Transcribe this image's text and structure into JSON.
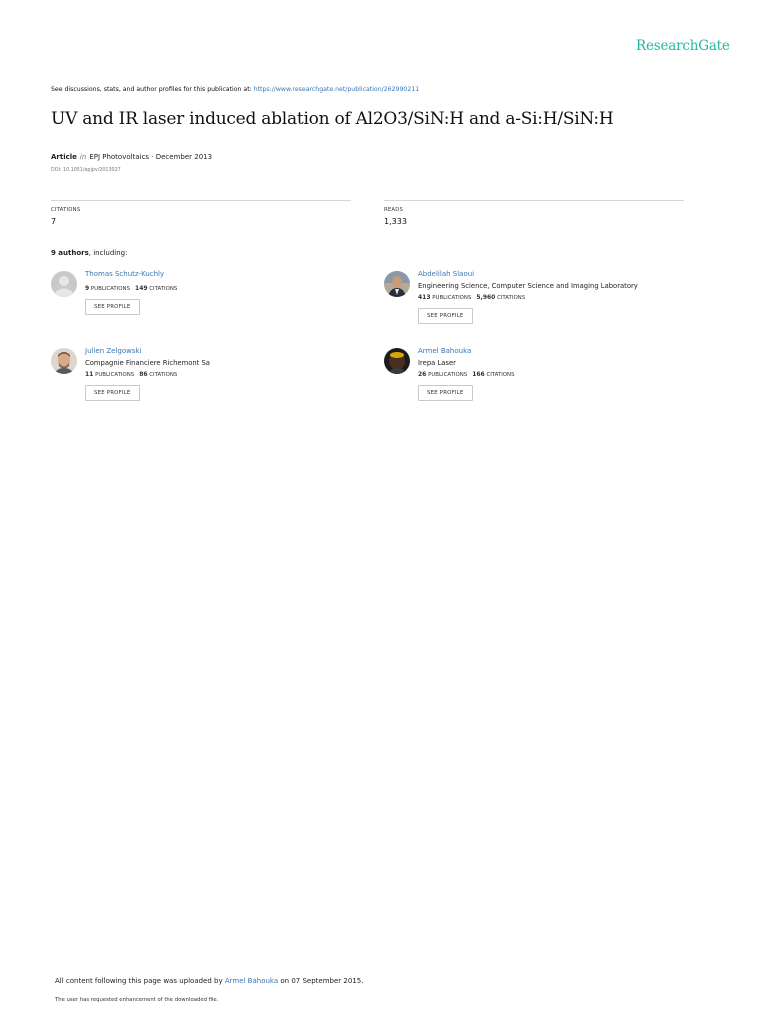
{
  "brand": "ResearchGate",
  "discussion": {
    "prefix": "See discussions, stats, and author profiles for this publication at: ",
    "url": "https://www.researchgate.net/publication/262990211"
  },
  "title": "UV and IR laser induced ablation of Al2O3/SiN:H and a-Si:H/SiN:H",
  "meta": {
    "type": "Article",
    "in_word": "in",
    "journal_date": "EPJ Photovoltaics · December 2013",
    "doi": "DOI: 10.1051/epjpv/2013027"
  },
  "stats": {
    "citations_label": "CITATIONS",
    "citations_value": "7",
    "reads_label": "READS",
    "reads_value": "1,333"
  },
  "authors_header": {
    "count": "9 authors",
    "suffix": ", including:"
  },
  "authors": [
    {
      "name": "Thomas Schutz-Kuchly",
      "institution": "",
      "publications": "9",
      "publications_label": "PUBLICATIONS",
      "citations": "149",
      "citations_label": "CITATIONS",
      "button": "SEE PROFILE"
    },
    {
      "name": "Abdelilah Slaoui",
      "institution": "Engineering Science, Computer Science and Imaging Laboratory",
      "publications": "413",
      "publications_label": "PUBLICATIONS",
      "citations": "5,960",
      "citations_label": "CITATIONS",
      "button": "SEE PROFILE"
    },
    {
      "name": "Julien Zelgowski",
      "institution": "Compagnie Financiere Richemont Sa",
      "publications": "11",
      "publications_label": "PUBLICATIONS",
      "citations": "86",
      "citations_label": "CITATIONS",
      "button": "SEE PROFILE"
    },
    {
      "name": "Armel Bahouka",
      "institution": "Irepa Laser",
      "publications": "26",
      "publications_label": "PUBLICATIONS",
      "citations": "166",
      "citations_label": "CITATIONS",
      "button": "SEE PROFILE"
    }
  ],
  "footer": {
    "upload_prefix": "All content following this page was uploaded by ",
    "uploader": "Armel Bahouka",
    "upload_suffix": " on 07 September 2015.",
    "note": "The user has requested enhancement of the downloaded file."
  },
  "colors": {
    "brand": "#22b8a4",
    "link": "#3a77b5"
  }
}
